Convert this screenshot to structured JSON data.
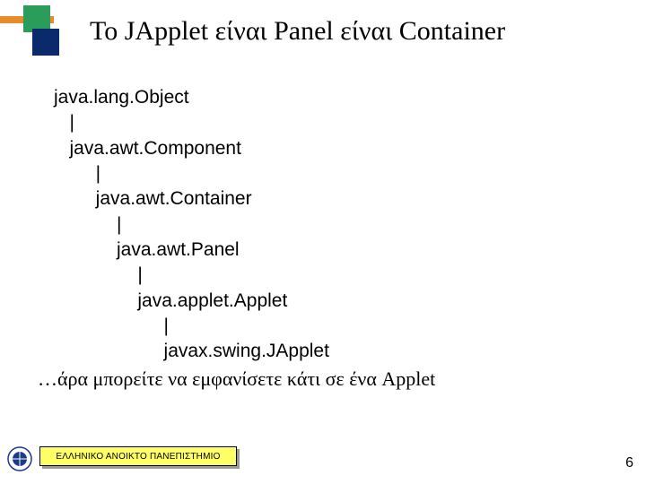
{
  "title": "Το JApplet είναι Panel είναι Container",
  "tree": {
    "l0": "java.lang.Object",
    "p0": "   |",
    "l1": "   java.awt.Component",
    "p1": "        |",
    "l2": "        java.awt.Container",
    "p2": "            |",
    "l3": "            java.awt.Panel",
    "p3": "                |",
    "l4": "                java.applet.Applet",
    "p4": "                     |",
    "l5": "                     javax.swing.JApplet"
  },
  "footnote": "…άρα μπορείτε να εμφανίσετε κάτι σε ένα Applet",
  "badge_label": "ΕΛΛΗΝΙΚΟ ΑΝΟΙΚΤΟ ΠΑΝΕΠΙΣΤΗΜΙΟ",
  "page_number": "6"
}
